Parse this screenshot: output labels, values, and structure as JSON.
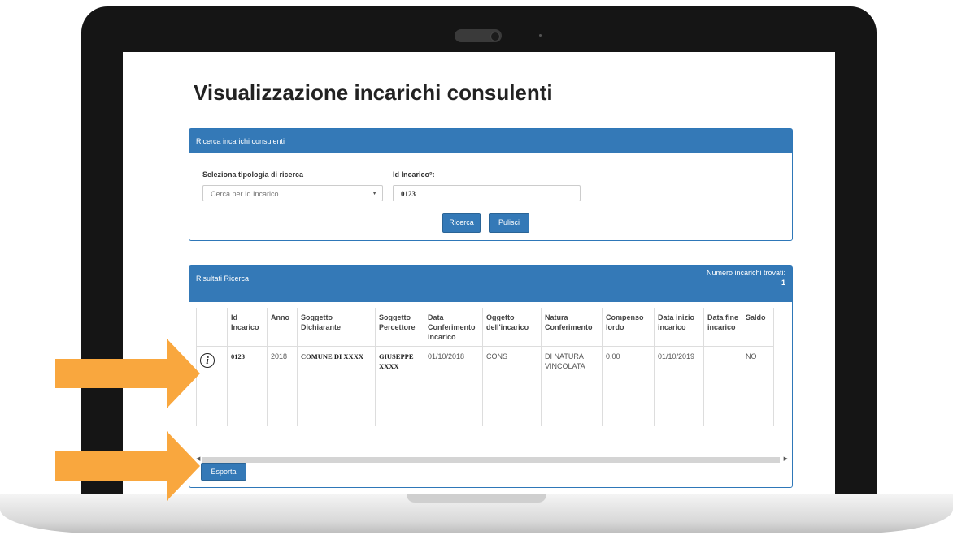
{
  "page": {
    "title": "Visualizzazione incarichi consulenti"
  },
  "search_panel": {
    "title": "Ricerca incarichi consulenti",
    "type_label": "Seleziona tipologia di ricerca",
    "type_value": "Cerca per Id Incarico",
    "id_label": "Id Incarico°:",
    "id_value": "0123",
    "search_button": "Ricerca",
    "clear_button": "Pulisci"
  },
  "results_panel": {
    "title": "Risultati Ricerca",
    "count_label": "Numero incarichi trovati:",
    "count_value": "1",
    "columns": [
      "",
      "Id Incarico",
      "Anno",
      "Soggetto Dichiarante",
      "Soggetto Percettore",
      "Data Conferimento incarico",
      "Oggetto dell'incarico",
      "Natura Conferimento",
      "Compenso lordo",
      "Data inizio incarico",
      "Data fine incarico",
      "Saldo"
    ],
    "rows": [
      {
        "id": "0123",
        "anno": "2018",
        "dichiarante": "COMUNE DI XXXX",
        "percettore": "GIUSEPPE XXXX",
        "data_conferimento": "01/10/2018",
        "oggetto": "CONS",
        "natura": "DI NATURA VINCOLATA",
        "compenso": "0,00",
        "data_inizio": "01/10/2019",
        "data_fine": "",
        "saldo": "NO"
      }
    ],
    "export_button": "Esporta"
  },
  "icons": {
    "info": "info-icon",
    "arrow_color": "#f9a73e"
  },
  "colors": {
    "panel_header": "#3479b7",
    "button": "#3479b7",
    "annotation_arrow": "#f9a73e"
  }
}
